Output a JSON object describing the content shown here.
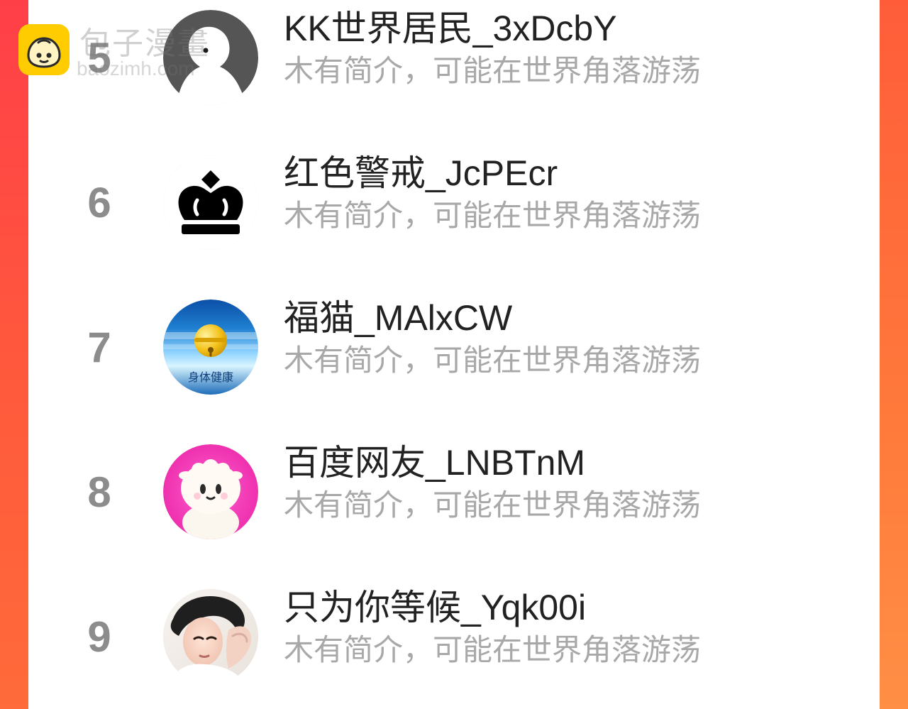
{
  "watermark": {
    "title": "包子漫畫",
    "url": "baozimh.com"
  },
  "list": {
    "items": [
      {
        "rank": "5",
        "name": "KK世界居民_3xDcbY",
        "bio": "木有简介，可能在世界角落游荡",
        "avatar_icon": "default-user-avatar-icon"
      },
      {
        "rank": "6",
        "name": "红色警戒_JcPEcr",
        "bio": "木有简介，可能在世界角落游荡",
        "avatar_icon": "crown-avatar-icon"
      },
      {
        "rank": "7",
        "name": "福猫_MAlxCW",
        "bio": "木有简介，可能在世界角落游荡",
        "avatar_icon": "bell-avatar-icon",
        "avatar_caption": "身体健康"
      },
      {
        "rank": "8",
        "name": "百度网友_LNBTnM",
        "bio": "木有简介，可能在世界角落游荡",
        "avatar_icon": "plush-lamb-avatar-icon"
      },
      {
        "rank": "9",
        "name": "只为你等候_Yqk00i",
        "bio": "木有简介，可能在世界角落游荡",
        "avatar_icon": "portrait-avatar-icon"
      }
    ]
  },
  "colors": {
    "edge_left": "#ff4a3d",
    "edge_right": "#ff7a3a",
    "rank_gray": "#8c8c8c",
    "name_dark": "#222222",
    "bio_gray": "#a8a8a8"
  }
}
